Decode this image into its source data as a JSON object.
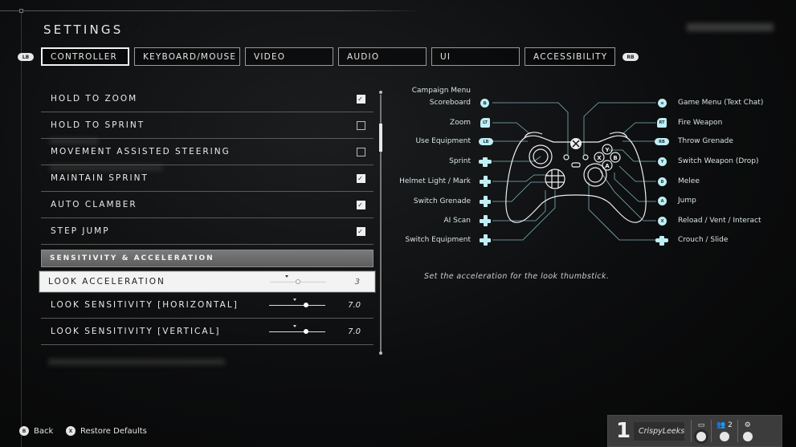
{
  "header": {
    "title": "SETTINGS"
  },
  "tabs": {
    "left_bumper": "LB",
    "right_bumper": "RB",
    "items": [
      {
        "label": "CONTROLLER",
        "active": true
      },
      {
        "label": "KEYBOARD/MOUSE",
        "active": false
      },
      {
        "label": "VIDEO",
        "active": false
      },
      {
        "label": "AUDIO",
        "active": false
      },
      {
        "label": "UI",
        "active": false
      },
      {
        "label": "ACCESSIBILITY",
        "active": false
      }
    ]
  },
  "settings": {
    "toggles": [
      {
        "label": "HOLD TO ZOOM",
        "checked": true
      },
      {
        "label": "HOLD TO SPRINT",
        "checked": false
      },
      {
        "label": "MOVEMENT ASSISTED STEERING",
        "checked": false
      },
      {
        "label": "MAINTAIN SPRINT",
        "checked": true
      },
      {
        "label": "AUTO CLAMBER",
        "checked": true
      },
      {
        "label": "STEP JUMP",
        "checked": true
      }
    ],
    "section_header": "SENSITIVITY & ACCELERATION",
    "sliders": [
      {
        "label": "LOOK ACCELERATION",
        "value": "3",
        "fraction": 0.5,
        "default_fraction": 0.3,
        "selected": true
      },
      {
        "label": "LOOK SENSITIVITY [HORIZONTAL]",
        "value": "7.0",
        "fraction": 0.65,
        "default_fraction": 0.45,
        "selected": false
      },
      {
        "label": "LOOK SENSITIVITY [VERTICAL]",
        "value": "7.0",
        "fraction": 0.65,
        "default_fraction": 0.45,
        "selected": false
      }
    ],
    "scroll_fraction": 0.12
  },
  "description": "Set the acceleration for the look thumbstick.",
  "controller_map": {
    "accent_color": "#bfeef5",
    "left": [
      {
        "label": "Campaign Menu",
        "icon": "",
        "icon_type": "none"
      },
      {
        "label": "Scoreboard",
        "icon": "⧉",
        "icon_type": "round"
      },
      {
        "label": "Zoom",
        "icon": "LT",
        "icon_type": "trigger"
      },
      {
        "label": "Use Equipment",
        "icon": "LB",
        "icon_type": "bumper"
      },
      {
        "label": "Sprint",
        "icon": "L",
        "icon_type": "stick"
      },
      {
        "label": "Helmet Light / Mark",
        "icon": "",
        "icon_type": "dpad"
      },
      {
        "label": "Switch Grenade",
        "icon": "",
        "icon_type": "dpad"
      },
      {
        "label": "AI Scan",
        "icon": "",
        "icon_type": "dpad"
      },
      {
        "label": "Switch Equipment",
        "icon": "",
        "icon_type": "dpad"
      }
    ],
    "right": [
      {
        "label": "Game Menu (Text Chat)",
        "icon": "≡",
        "icon_type": "round"
      },
      {
        "label": "Fire Weapon",
        "icon": "RT",
        "icon_type": "trigger"
      },
      {
        "label": "Throw Grenade",
        "icon": "RB",
        "icon_type": "bumper"
      },
      {
        "label": "Switch Weapon (Drop)",
        "icon": "Y",
        "icon_type": "round"
      },
      {
        "label": "Melee",
        "icon": "B",
        "icon_type": "round"
      },
      {
        "label": "Jump",
        "icon": "A",
        "icon_type": "round"
      },
      {
        "label": "Reload / Vent / Interact",
        "icon": "X",
        "icon_type": "round"
      },
      {
        "label": "Crouch / Slide",
        "icon": "R",
        "icon_type": "stick"
      }
    ]
  },
  "footer": {
    "back": {
      "button": "B",
      "label": "Back"
    },
    "restore": {
      "button": "X",
      "label": "Restore Defaults"
    }
  },
  "player_card": {
    "rank": "1",
    "gamertag": "CrispyLeeks",
    "party_count": "2",
    "chat_icon": "chat-icon",
    "party_icon": "party-icon",
    "settings_icon": "gear-icon"
  }
}
